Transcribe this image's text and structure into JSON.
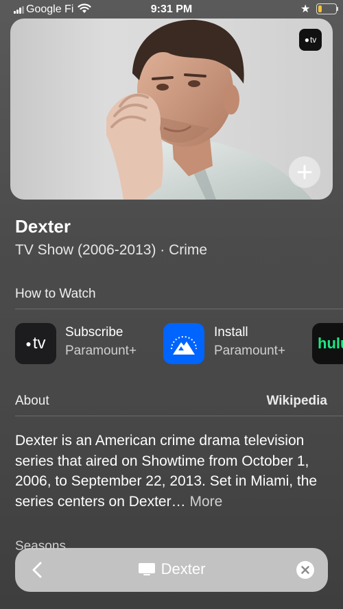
{
  "status_bar": {
    "carrier": "Google Fi",
    "time": "9:31 PM",
    "battery_level": 0.2,
    "battery_color": "#f3c53a"
  },
  "hero": {
    "badge_icon": "apple-tv-icon",
    "badge_label": "tv",
    "add_icon": "plus-icon"
  },
  "show": {
    "title": "Dexter",
    "subtitle": "TV Show (2006-2013) · Crime"
  },
  "how_to_watch": {
    "heading": "How to Watch",
    "providers": [
      {
        "icon": "apple-tv-app-icon",
        "icon_label": "tv",
        "action": "Subscribe",
        "service": "Paramount+"
      },
      {
        "icon": "paramount-plus-icon",
        "action": "Install",
        "service": "Paramount+"
      },
      {
        "icon": "hulu-icon",
        "icon_label": "hulu"
      }
    ]
  },
  "about": {
    "heading": "About",
    "source": "Wikipedia",
    "text": "Dexter is an American crime drama television series that aired on Showtime from October 1, 2006, to September 22, 2013. Set in Miami, the series centers on Dexter…",
    "more": "More"
  },
  "seasons": {
    "heading": "Seasons"
  },
  "bottom_bar": {
    "back_icon": "chevron-left-icon",
    "tv_icon": "tv-icon",
    "title": "Dexter",
    "close_icon": "close-icon"
  }
}
